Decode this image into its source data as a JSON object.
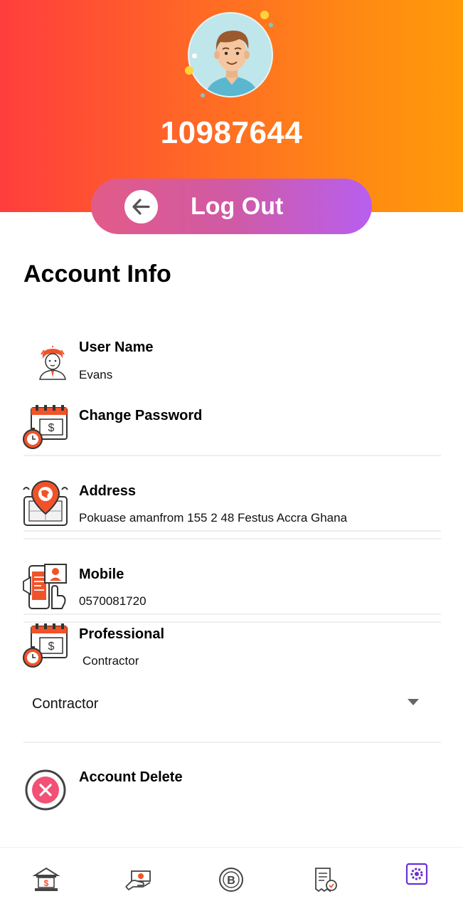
{
  "profile": {
    "user_id": "10987644"
  },
  "logout": {
    "label": "Log Out"
  },
  "account_info": {
    "title": "Account Info",
    "user_name": {
      "label": "User Name",
      "value": "Evans"
    },
    "change_password": {
      "label": "Change Password"
    },
    "address": {
      "label": "Address",
      "value": "Pokuase amanfrom 155 2 48 Festus Accra Ghana"
    },
    "mobile": {
      "label": "Mobile",
      "value": "0570081720"
    },
    "professional": {
      "label": "Professional",
      "value": "Contractor"
    },
    "professional_select": {
      "selected": "Contractor"
    },
    "account_delete": {
      "label": "Account Delete"
    }
  },
  "bottom_nav": {
    "items": [
      "bank-icon",
      "money-transfer-icon",
      "bitcoin-icon",
      "receipt-icon",
      "settings-icon"
    ],
    "active": "settings-icon"
  },
  "colors": {
    "header_gradient_start": "#ff3d3d",
    "header_gradient_end": "#ff9a08",
    "logout_gradient_start": "#e25b88",
    "logout_gradient_end": "#b85ff0",
    "icon_accent": "#f0532a",
    "nav_active": "#6a2fd6"
  }
}
